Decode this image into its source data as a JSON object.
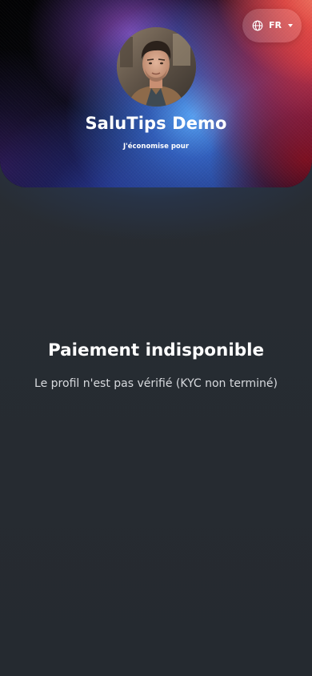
{
  "language_switch": {
    "icon": "globe-icon",
    "code": "FR",
    "caret_icon": "caret-down-icon"
  },
  "profile": {
    "name": "SaluTips Demo",
    "subtitle": "J'économise pour",
    "avatar": "profile-photo"
  },
  "message": {
    "title": "Paiement indisponible",
    "body": "Le profil n'est pas vérifié (KYC non terminé)"
  },
  "colors": {
    "background": "#262b31",
    "text_primary": "#ffffff",
    "text_secondary": "#d7dade"
  }
}
